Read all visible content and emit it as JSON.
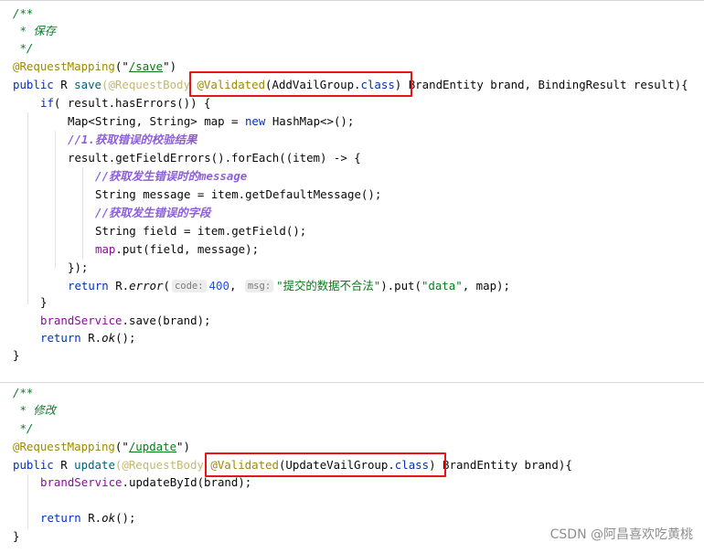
{
  "save": {
    "doc_open": "/**",
    "doc_text": " * 保存",
    "doc_close": " */",
    "mapping": "@RequestMapping",
    "mapping_paren_open": "(\"",
    "mapping_path": "/save",
    "mapping_paren_close": "\")",
    "sig_prefix_public": "public",
    "sig_prefix_rest": " R ",
    "method_name": "save",
    "req_body": "(@RequestBody ",
    "validated": "@Validated",
    "validated_args": "(AddVailGroup.",
    "validated_class": "class",
    "validated_close": ")",
    "sig_rest": " BrandEntity brand, BindingResult result){",
    "if_kw": "if",
    "if_rest": "( result.hasErrors()) {",
    "map_decl": "Map<String, String> map = ",
    "new_kw": "new",
    "map_decl_rest": " HashMap<>();",
    "comment1": "//1.获取错误的校验结果",
    "foreach_line": "result.getFieldErrors().forEach((item) -> {",
    "comment2": "//获取发生错误时的message",
    "message_line": "String message = item.getDefaultMessage();",
    "comment3": "//获取发生错误的字段",
    "field_line": "String field = item.getField();",
    "map_put_var": "map",
    "map_put_rest": ".put(field, message);",
    "lambda_close": "});",
    "return_kw": "return",
    "return_r": " R.",
    "return_error": "error",
    "return_paren": "(",
    "hint_code": "code:",
    "code_value": "400",
    "comma": ", ",
    "hint_msg": "msg:",
    "msg_value": "\"提交的数据不合法\"",
    "put_open": ").put(",
    "data_key": "\"data\"",
    "put_close": ", map);",
    "if_close": "}",
    "service_var": "brandService",
    "service_save": ".save(brand);",
    "return_r2": " R.",
    "ok": "ok",
    "ok_rest": "();",
    "method_close": "}"
  },
  "update": {
    "doc_open": "/**",
    "doc_text": " * 修改",
    "doc_close": " */",
    "mapping": "@RequestMapping",
    "mapping_paren_open": "(\"",
    "mapping_path": "/update",
    "mapping_paren_close": "\")",
    "sig_prefix_public": "public",
    "sig_prefix_rest": " R ",
    "method_name": "update",
    "req_body": "(@RequestBody ",
    "validated": "@Validated",
    "validated_args": "(UpdateVailGroup.",
    "validated_class": "class",
    "validated_close": ")",
    "sig_rest": " BrandEntity brand){",
    "service_var": "brandService",
    "service_update": ".updateById(brand);",
    "return_kw": "return",
    "return_r": " R.",
    "ok": "ok",
    "ok_rest": "();",
    "method_close": "}"
  },
  "watermark": "CSDN @阿昌喜欢吃黄桃",
  "colors": {
    "keyword": "#0033b3",
    "annotation": "#9e880d",
    "string": "#067d17",
    "number": "#1750eb",
    "highlight_box": "#e8141a",
    "todo_comment": "#8c5fd9"
  }
}
